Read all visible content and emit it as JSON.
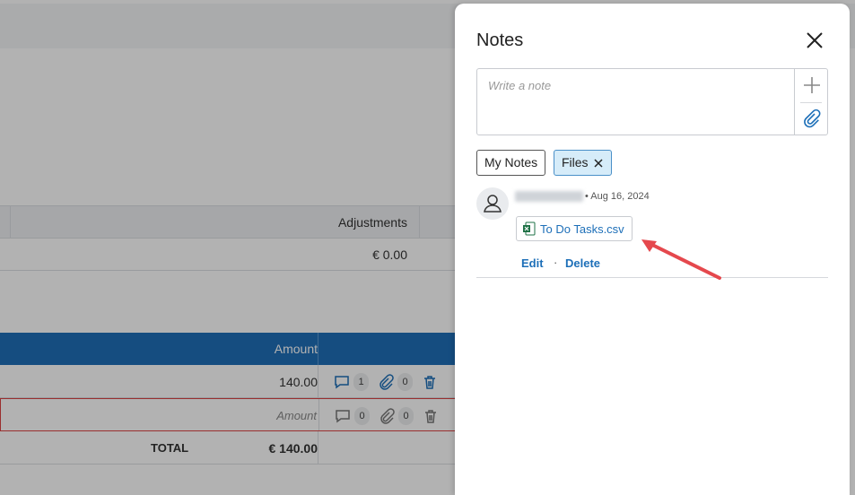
{
  "background": {
    "adjustments_header": "Adjustments",
    "adjustments_value": "€ 0.00",
    "amount_header": "Amount",
    "rows": [
      {
        "amount": "140.00",
        "comments_count": "1",
        "attachments_count": "0"
      },
      {
        "amount_placeholder": "Amount",
        "comments_count": "0",
        "attachments_count": "0"
      }
    ],
    "total_label": "TOTAL",
    "total_value": "€ 140.00"
  },
  "notes": {
    "title": "Notes",
    "input_placeholder": "Write a note",
    "filters": {
      "my_notes": "My Notes",
      "files": "Files"
    },
    "entry": {
      "date": "• Aug 16, 2024",
      "file_name": "To Do Tasks.csv",
      "edit_label": "Edit",
      "separator": "·",
      "delete_label": "Delete"
    }
  },
  "colors": {
    "accent": "#1d6fb8",
    "header_blue": "#1f6fb8",
    "arrow": "#e5484d",
    "chip_active": "#d6ecf9"
  }
}
